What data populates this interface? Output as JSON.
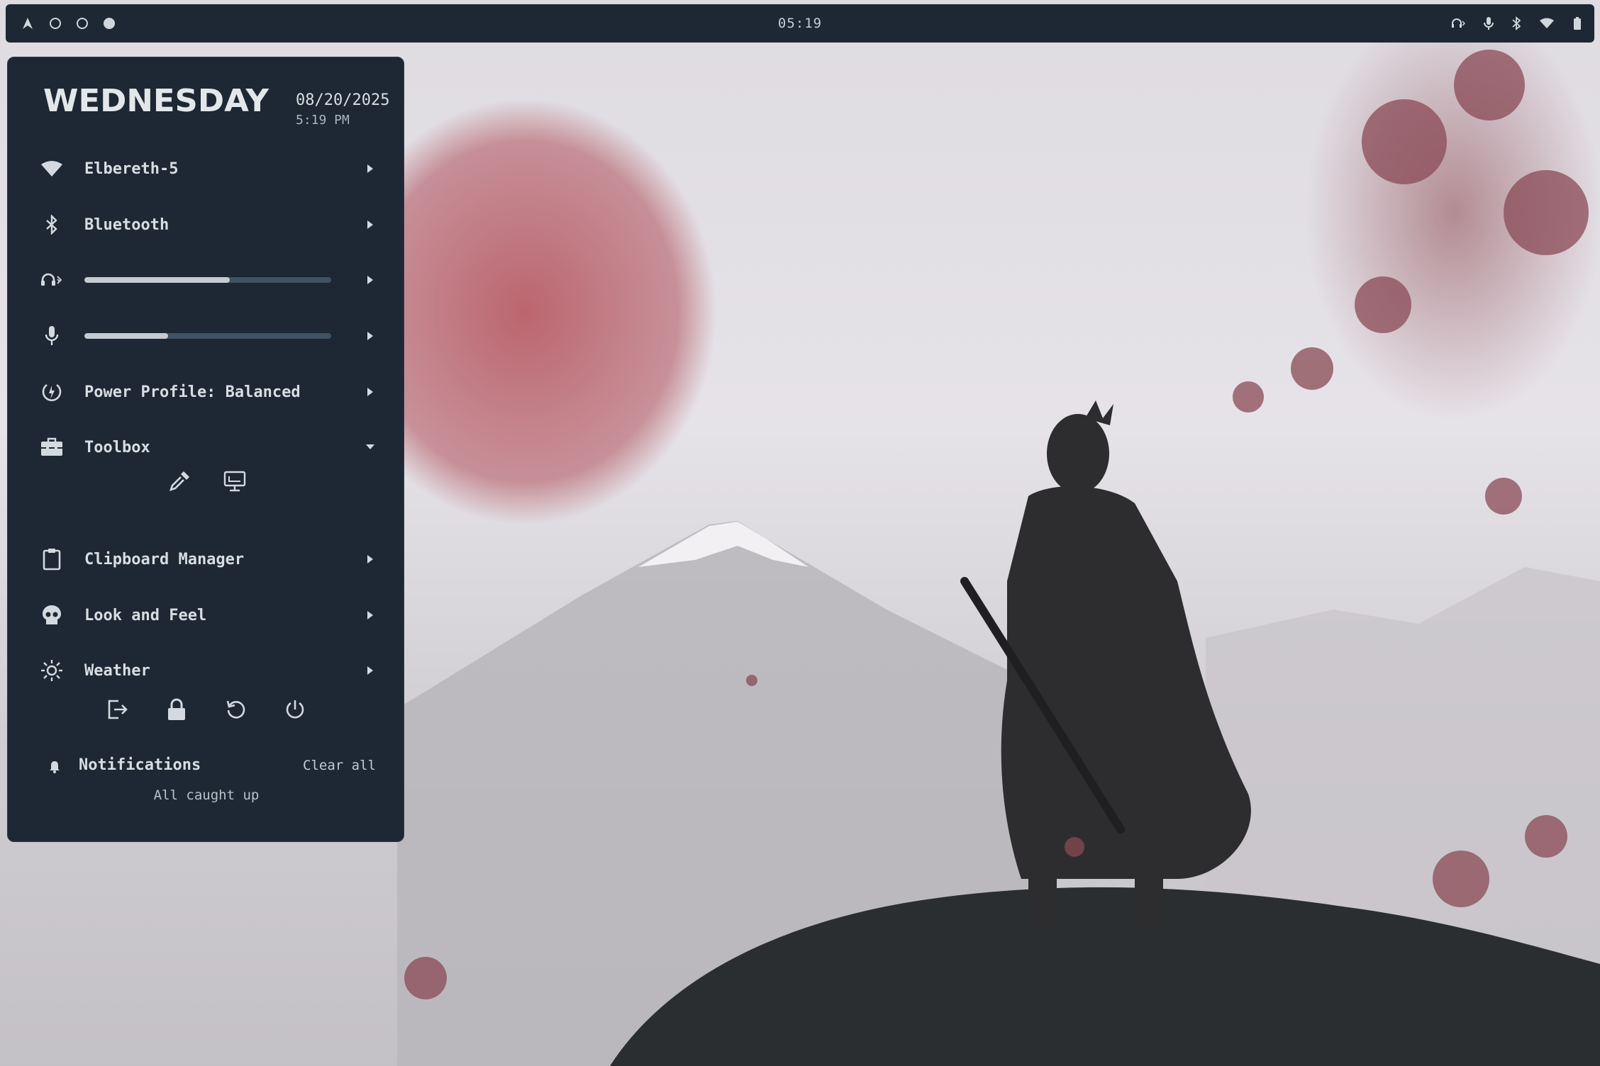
{
  "topbar": {
    "clock": "05:19",
    "workspaces": [
      "launcher-icon",
      "workspace-1",
      "workspace-2",
      "workspace-3"
    ],
    "status_icons": [
      "headphones-bluetooth-icon",
      "microphone-icon",
      "bluetooth-icon",
      "wifi-icon",
      "battery-icon"
    ]
  },
  "panel": {
    "logo_text": "WEDNESDAY",
    "date": "08/20/2025",
    "time": "5:19 PM",
    "wifi": {
      "label": "Elbereth-5",
      "icon": "wifi-icon"
    },
    "bluetooth": {
      "label": "Bluetooth",
      "icon": "bluetooth-icon"
    },
    "volume": {
      "level": 0.59,
      "icon": "headphones-bluetooth-icon"
    },
    "mic": {
      "level": 0.34,
      "icon": "microphone-icon"
    },
    "power_profile": {
      "label": "Power Profile: Balanced",
      "icon": "power-profile-icon"
    },
    "toolbox": {
      "label": "Toolbox",
      "icon": "toolbox-icon",
      "expanded": true,
      "tools": [
        "color-picker-icon",
        "screenshot-monitor-icon"
      ]
    },
    "clipboard": {
      "label": "Clipboard Manager",
      "icon": "clipboard-icon"
    },
    "look_and_feel": {
      "label": "Look and Feel",
      "icon": "skull-icon"
    },
    "weather": {
      "label": "Weather",
      "icon": "sun-icon"
    },
    "session_buttons": [
      "logout-icon",
      "lock-icon",
      "restart-icon",
      "power-icon"
    ],
    "notifications": {
      "title": "Notifications",
      "clear_label": "Clear all",
      "empty_text": "All caught up"
    }
  },
  "colors": {
    "panel_bg": "#1d2834",
    "text": "#d8dde2",
    "slider_track": "#3f5262",
    "slider_fill": "#c4cbd1"
  }
}
